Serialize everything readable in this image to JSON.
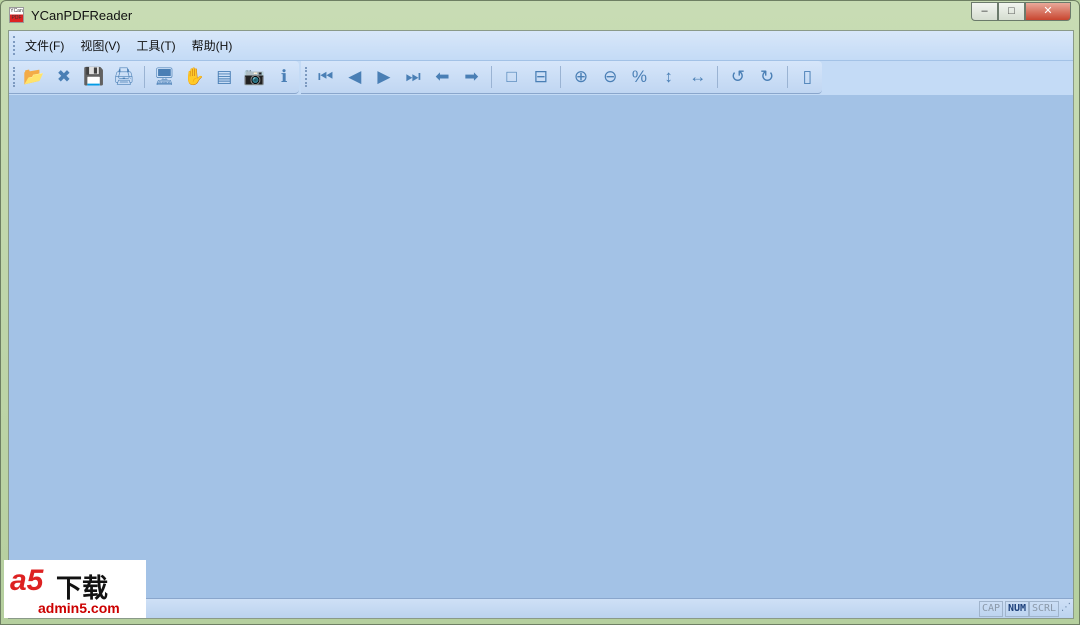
{
  "window": {
    "title": "YCanPDFReader",
    "app_icon_text": "YCan PDF",
    "minimize": "–",
    "maximize": "□",
    "close": "✕"
  },
  "menu": [
    "文件(F)",
    "视图(V)",
    "工具(T)",
    "帮助(H)"
  ],
  "toolbar1": [
    {
      "name": "open-folder",
      "glyph": "📂"
    },
    {
      "name": "close-file",
      "glyph": "✖"
    },
    {
      "name": "save",
      "glyph": "💾"
    },
    {
      "name": "print",
      "glyph": "🖨"
    },
    {
      "sep": true
    },
    {
      "name": "fullscreen-monitor",
      "glyph": "🖥"
    },
    {
      "name": "hand-tool",
      "glyph": "✋"
    },
    {
      "name": "thumbnails",
      "glyph": "▤"
    },
    {
      "name": "snapshot-camera",
      "glyph": "📷"
    },
    {
      "name": "info",
      "glyph": "ℹ"
    }
  ],
  "toolbar2": [
    {
      "name": "first-page",
      "glyph": "⏮"
    },
    {
      "name": "previous-page",
      "glyph": "◀"
    },
    {
      "name": "next-page",
      "glyph": "▶"
    },
    {
      "name": "last-page",
      "glyph": "⏭"
    },
    {
      "name": "back",
      "glyph": "⬅"
    },
    {
      "name": "forward",
      "glyph": "➡"
    },
    {
      "sep": true
    },
    {
      "name": "single-page",
      "glyph": "□"
    },
    {
      "name": "continuous-page",
      "glyph": "⊟"
    },
    {
      "sep": true
    },
    {
      "name": "zoom-in",
      "glyph": "⊕"
    },
    {
      "name": "zoom-out",
      "glyph": "⊖"
    },
    {
      "name": "actual-size-100",
      "glyph": "%"
    },
    {
      "name": "fit-height",
      "glyph": "↕"
    },
    {
      "name": "fit-width",
      "glyph": "↔"
    },
    {
      "sep": true
    },
    {
      "name": "rotate-left",
      "glyph": "↺"
    },
    {
      "name": "rotate-right",
      "glyph": "↻"
    },
    {
      "sep": true
    },
    {
      "name": "bookmark",
      "glyph": "▯"
    }
  ],
  "status": {
    "cap": "CAP",
    "num": "NUM",
    "scrl": "SCRL"
  },
  "watermark": {
    "logo": "a5",
    "text": "下载",
    "url": "admin5.com"
  }
}
